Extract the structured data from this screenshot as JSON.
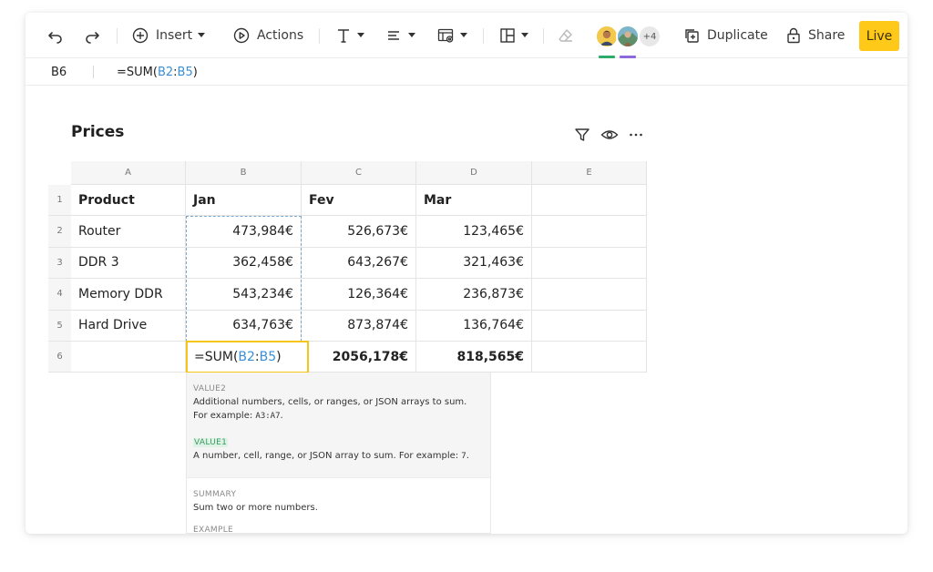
{
  "toolbar": {
    "insert_label": "Insert",
    "actions_label": "Actions",
    "collaborators_more": "+4",
    "duplicate_label": "Duplicate",
    "share_label": "Share",
    "live_label": "Live",
    "presence_colors": [
      "#2eaa6b",
      "#8c6ad9"
    ],
    "accent_live": "#ffc91a"
  },
  "formula_bar": {
    "cell_ref": "B6",
    "formula_prefix": "=SUM(",
    "formula_ref_start": "B2",
    "formula_colon": ":",
    "formula_ref_end": "B5",
    "formula_suffix": ")"
  },
  "table": {
    "title": "Prices",
    "columns": [
      "A",
      "B",
      "C",
      "D",
      "E"
    ],
    "row_numbers": [
      "1",
      "2",
      "3",
      "4",
      "5",
      "6"
    ],
    "header": [
      "Product",
      "Jan",
      "Fev",
      "Mar",
      ""
    ],
    "rows": [
      [
        "Router",
        "473,984€",
        "526,673€",
        "123,465€",
        ""
      ],
      [
        "DDR 3",
        "362,458€",
        "643,267€",
        "321,463€",
        ""
      ],
      [
        "Memory DDR",
        "543,234€",
        "126,364€",
        "236,873€",
        ""
      ],
      [
        "Hard Drive",
        "634,763€",
        "873,874€",
        "136,764€",
        ""
      ]
    ],
    "totals": [
      "",
      "=SUM(B2:B5)",
      "2056,178€",
      "818,565€",
      ""
    ],
    "active_cell_parts": [
      "=SUM(",
      "B2",
      ":",
      "B5",
      ")"
    ]
  },
  "popup": {
    "value2_label": "VALUE2",
    "value2_text": "Additional numbers, cells, or ranges, or JSON arrays to sum. For example: ",
    "value2_example": "A3:A7",
    "value2_end": ".",
    "value1_label": "VALUE1",
    "value1_text": "A number, cell, range, or JSON array to sum. For example: ",
    "value1_example": "7",
    "value1_end": ".",
    "summary_label": "SUMMARY",
    "summary_text": "Sum two or more numbers.",
    "example_label": "EXAMPLE"
  }
}
